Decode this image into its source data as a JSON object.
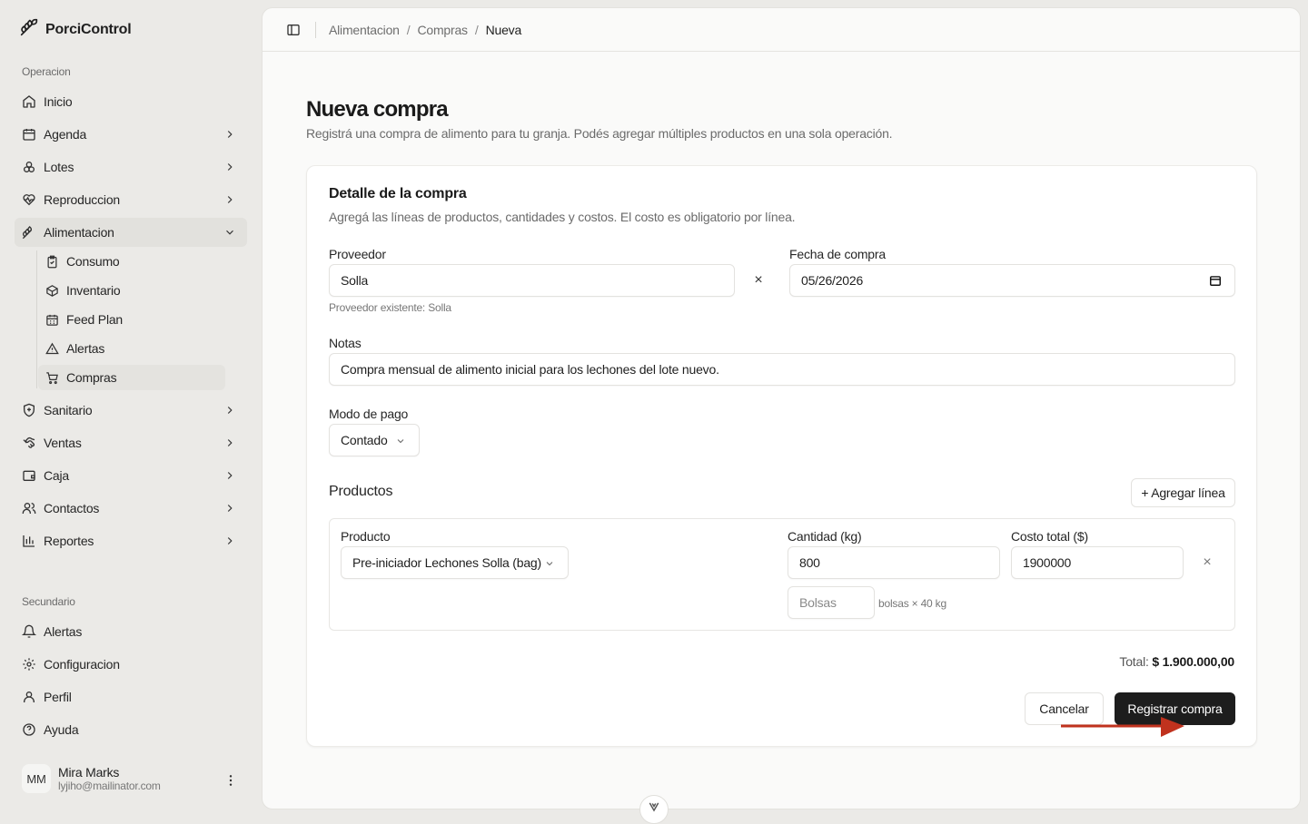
{
  "app": {
    "name": "PorciControl"
  },
  "sidebar": {
    "section_operacion": "Operacion",
    "items": [
      {
        "label": "Inicio"
      },
      {
        "label": "Agenda"
      },
      {
        "label": "Lotes"
      },
      {
        "label": "Reproduccion"
      },
      {
        "label": "Alimentacion"
      },
      {
        "label": "Sanitario"
      },
      {
        "label": "Ventas"
      },
      {
        "label": "Caja"
      },
      {
        "label": "Contactos"
      },
      {
        "label": "Reportes"
      }
    ],
    "sub_items": [
      {
        "label": "Consumo"
      },
      {
        "label": "Inventario"
      },
      {
        "label": "Feed Plan"
      },
      {
        "label": "Alertas"
      },
      {
        "label": "Compras"
      }
    ],
    "section_secundario": "Secundario",
    "secondary_items": [
      {
        "label": "Alertas"
      },
      {
        "label": "Configuracion"
      },
      {
        "label": "Perfil"
      },
      {
        "label": "Ayuda"
      }
    ],
    "user": {
      "initials": "MM",
      "name": "Mira Marks",
      "email": "lyjiho@mailinator.com"
    }
  },
  "breadcrumb": [
    "Alimentacion",
    "Compras",
    "Nueva"
  ],
  "page": {
    "title": "Nueva compra",
    "subtitle": "Registrá una compra de alimento para tu granja. Podés agregar múltiples productos en una sola operación."
  },
  "card": {
    "title": "Detalle de la compra",
    "subtitle": "Agregá las líneas de productos, cantidades y costos. El costo es obligatorio por línea."
  },
  "form": {
    "proveedor_label": "Proveedor",
    "proveedor_value": "Solla",
    "proveedor_hint": "Proveedor existente: Solla",
    "clear_symbol": "×",
    "fecha_label": "Fecha de compra",
    "fecha_value": "05/26/2026",
    "notas_label": "Notas",
    "notas_value": "Compra mensual de alimento inicial para los lechones del lote nuevo.",
    "modo_pago_label": "Modo de pago",
    "modo_pago_value": "Contado"
  },
  "productos": {
    "title": "Productos",
    "add_line_label": "+ Agregar línea",
    "line": {
      "producto_label": "Producto",
      "producto_value": "Pre-iniciador Lechones Solla (bag)",
      "cantidad_label": "Cantidad (kg)",
      "cantidad_value": "800",
      "costo_label": "Costo total ($)",
      "costo_value": "1900000",
      "bolsas_placeholder": "Bolsas",
      "bolsas_hint": "bolsas × 40 kg",
      "remove_symbol": "×"
    }
  },
  "total": {
    "label": "Total:",
    "value": "$ 1.900.000,00"
  },
  "actions": {
    "cancel_label": "Cancelar",
    "submit_label": "Registrar compra"
  },
  "colors": {
    "accent_dark": "#1d1d1d",
    "annotation_arrow": "#c0321e",
    "sidebar_bg": "#ebeae7"
  }
}
